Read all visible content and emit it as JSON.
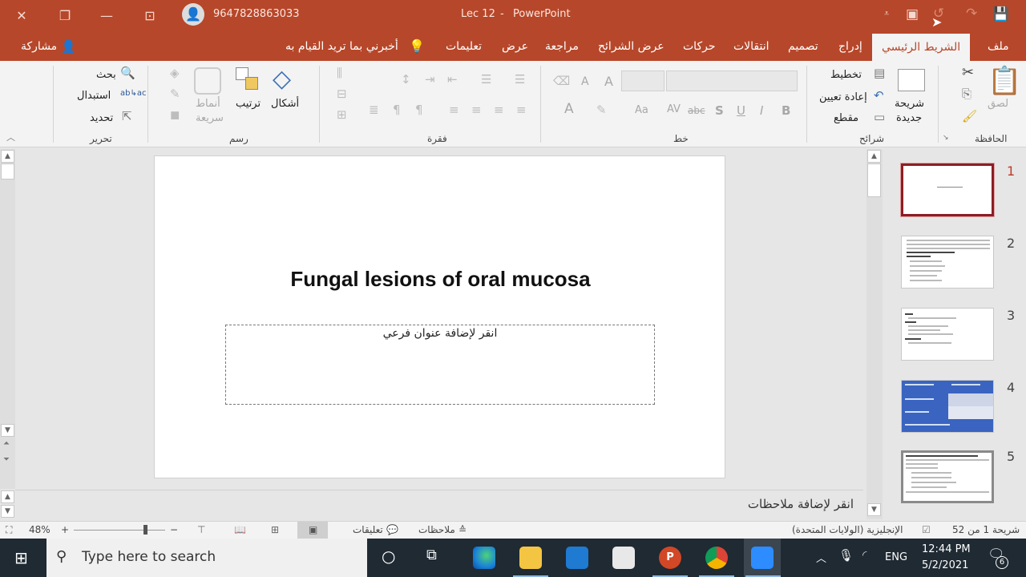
{
  "titlebar": {
    "close_icon": "close-icon",
    "restore_icon": "restore-icon",
    "minimize_icon": "minimize-icon",
    "ribbon_display_icon": "ribbon-display-options-icon",
    "account": "9647828863033",
    "document_title": "Lec 12",
    "separator": "-",
    "app_name": "PowerPoint",
    "quick_access": [
      "customize-qat-icon",
      "present-from-start-icon",
      "undo-icon",
      "redo-icon",
      "save-icon"
    ]
  },
  "tabs": {
    "file": "ملف",
    "home": "الشريط الرئيسي",
    "insert": "إدراج",
    "design": "تصميم",
    "transitions": "انتقالات",
    "animations": "حركات",
    "slideshow": "عرض الشرائح",
    "review": "مراجعة",
    "view": "عرض",
    "help": "تعليمات",
    "tell_me": "أخبرني بما تريد القيام به",
    "share": "مشاركة"
  },
  "ribbon": {
    "clipboard": {
      "label": "الحافظة",
      "paste": "لصق"
    },
    "slides": {
      "label": "شرائح",
      "new_slide_line1": "شريحة",
      "new_slide_line2": "جديدة",
      "layout": "تخطيط",
      "reset": "إعادة تعيين",
      "section": "مقطع"
    },
    "font": {
      "label": "خط",
      "font_name": "",
      "font_size": "",
      "bold": "B",
      "italic": "I",
      "underline": "U",
      "shadow": "S",
      "strike": "abc",
      "spacing": "AV",
      "case": "Aa",
      "color": "A",
      "grow": "A",
      "shrink": "A"
    },
    "paragraph": {
      "label": "فقرة"
    },
    "drawing": {
      "label": "رسم",
      "shapes": "أشكال",
      "arrange": "ترتيب",
      "quick_styles_line1": "أنماط",
      "quick_styles_line2": "سريعة"
    },
    "editing": {
      "label": "تحرير",
      "find": "بحث",
      "replace": "استبدال",
      "select": "تحديد"
    }
  },
  "slide": {
    "title": "Fungal lesions of oral mucosa",
    "subtitle_placeholder": "انقر لإضافة عنوان فرعي"
  },
  "notes": {
    "placeholder": "انقر لإضافة ملاحظات"
  },
  "thumbnails": [
    {
      "number": "1",
      "selected": true,
      "kind": "title"
    },
    {
      "number": "2",
      "selected": false,
      "kind": "text"
    },
    {
      "number": "3",
      "selected": false,
      "kind": "text"
    },
    {
      "number": "4",
      "selected": false,
      "kind": "table-blue"
    },
    {
      "number": "5",
      "selected": false,
      "kind": "text-framed"
    }
  ],
  "statusbar": {
    "slide_info": "شريحة 1 من 52",
    "language": "الإنجليزية (الولايات المتحدة)",
    "notes": "ملاحظات",
    "comments": "تعليقات",
    "zoom": "48%",
    "zoom_plus": "+",
    "zoom_minus": "−"
  },
  "taskbar": {
    "search_placeholder": "Type here to search",
    "apps": [
      "cortana",
      "task-view",
      "edge",
      "file-explorer",
      "mail",
      "store",
      "powerpoint",
      "chrome",
      "zoom"
    ],
    "language": "ENG",
    "time": "12:44 PM",
    "date": "5/2/2021",
    "notification_count": "6"
  },
  "colors": {
    "accent": "#b7472a",
    "selected_thumb": "#8b1e24",
    "taskbar": "#1f2a33"
  }
}
